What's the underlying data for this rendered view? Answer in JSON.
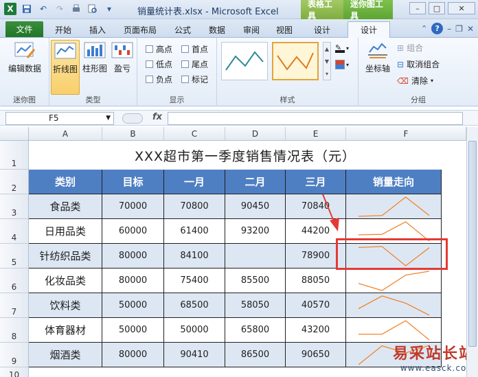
{
  "window": {
    "title": "销量统计表.xlsx - Microsoft Excel",
    "context_tab_groups": [
      "表格工具",
      "迷你图工具"
    ]
  },
  "tabs": [
    "文件",
    "开始",
    "插入",
    "页面布局",
    "公式",
    "数据",
    "审阅",
    "视图",
    "设计",
    "设计"
  ],
  "ribbon": {
    "sparkline_group": {
      "button": "编辑数据",
      "label": "迷你图"
    },
    "type_group": {
      "buttons": [
        "折线图",
        "柱形图",
        "盈亏"
      ],
      "label": "类型"
    },
    "show_group": {
      "checkboxes": [
        "高点",
        "首点",
        "低点",
        "尾点",
        "负点",
        "标记"
      ],
      "label": "显示"
    },
    "style_group": {
      "label": "样式"
    },
    "group_group": {
      "axis": "坐标轴",
      "group_btn": "组合",
      "ungroup_btn": "取消组合",
      "clear_btn": "清除",
      "label": "分组"
    }
  },
  "formula_bar": {
    "name_box": "F5",
    "fx": "fx",
    "formula": ""
  },
  "columns": [
    "A",
    "B",
    "C",
    "D",
    "E",
    "F"
  ],
  "rows": [
    "1",
    "2",
    "3",
    "4",
    "5",
    "6",
    "7",
    "8",
    "9",
    "10"
  ],
  "sheet": {
    "title": "XXX超市第一季度销售情况表（元）",
    "headers": [
      "类别",
      "目标",
      "一月",
      "二月",
      "三月",
      "销量走向"
    ],
    "data": [
      [
        "食品类",
        "70000",
        "70800",
        "90450",
        "70840"
      ],
      [
        "日用品类",
        "60000",
        "61400",
        "93200",
        "44200"
      ],
      [
        "针纺织品类",
        "80000",
        "84100",
        "",
        "78900"
      ],
      [
        "化妆品类",
        "80000",
        "75400",
        "85500",
        "88050"
      ],
      [
        "饮料类",
        "50000",
        "68500",
        "58050",
        "40570"
      ],
      [
        "体育器材",
        "50000",
        "50000",
        "65800",
        "43200"
      ],
      [
        "烟酒类",
        "80000",
        "90410",
        "86500",
        "90650"
      ]
    ]
  },
  "colors": {
    "sparkline": "#f0862e",
    "header_fill": "#4f7fc3",
    "band_fill": "#dde7f3",
    "selection": "#e53935"
  },
  "watermark": {
    "text_cn": "易采站长站",
    "text_url": "www.easck.com"
  }
}
